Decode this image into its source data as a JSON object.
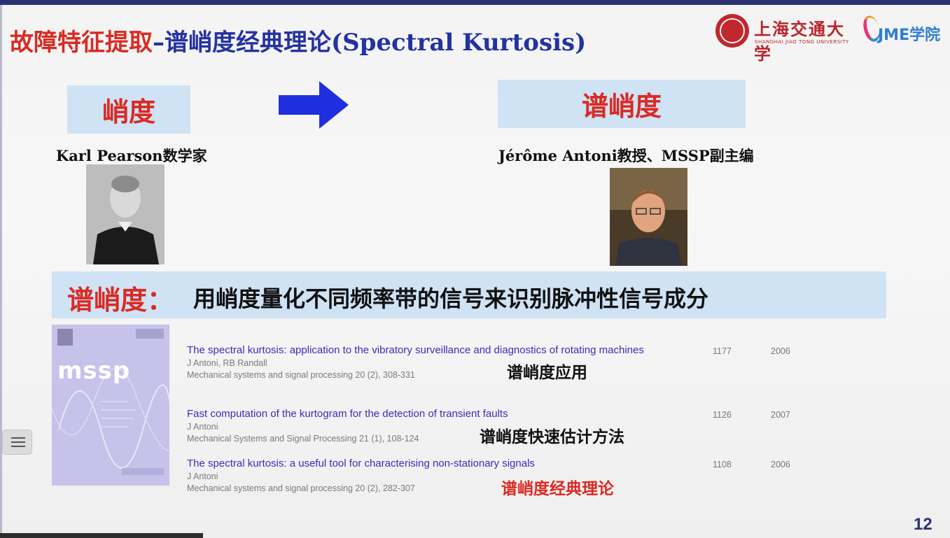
{
  "title": {
    "part1": "故障特征提取",
    "dash": "–",
    "part2": "谱峭度经典理论",
    "part3": "(Spectral Kurtosis)"
  },
  "logos": {
    "sjtu_cn": "上海交通大学",
    "sjtu_en": "SHANGHAI JIAO TONG UNIVERSITY",
    "jme": "JME学院"
  },
  "concept": {
    "left_box": "峭度",
    "right_box": "谱峭度",
    "left_person": "Karl Pearson数学家",
    "right_person": "Jérôme Antoni教授、MSSP副主编"
  },
  "definition": {
    "label": "谱峭度：",
    "text": "用峭度量化不同频率带的信号来识别脉冲性信号成分"
  },
  "journal_cover": {
    "logo": "mssp"
  },
  "publications": [
    {
      "title": "The spectral kurtosis: application to the vibratory surveillance and diagnostics of rotating machines",
      "authors": "J Antoni, RB Randall",
      "source": "Mechanical systems and signal processing 20 (2), 308-331",
      "citations": "1177",
      "year": "2006",
      "note": "谱峭度应用"
    },
    {
      "title": "Fast computation of the kurtogram for the detection of transient faults",
      "authors": "J Antoni",
      "source": "Mechanical Systems and Signal Processing 21 (1), 108-124",
      "citations": "1126",
      "year": "2007",
      "note": "谱峭度快速估计方法"
    },
    {
      "title": "The spectral kurtosis: a useful tool for characterising non-stationary signals",
      "authors": "J Antoni",
      "source": "Mechanical systems and signal processing 20 (2), 282-307",
      "citations": "1108",
      "year": "2006",
      "note": "谱峭度经典理论"
    }
  ],
  "page_number": "12",
  "colors": {
    "title_red": "#d92b24",
    "title_blue": "#2432a0",
    "box_blue": "#cfe3f5",
    "link_blue": "#3a2dbb",
    "arrow_blue": "#1f2fe0"
  },
  "icons": {
    "arrow": "right-arrow-icon",
    "menu": "list-menu-icon"
  }
}
